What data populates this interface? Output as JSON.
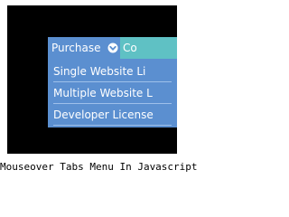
{
  "menu": {
    "tabs": [
      {
        "label": "Purchase",
        "icon": "chevron-down-circle-icon",
        "color": "#5b8fd0"
      },
      {
        "label": "Co",
        "color": "#5fc1c4"
      }
    ],
    "dropdown_items": [
      {
        "label": "Single Website Li"
      },
      {
        "label": "Multiple Website L"
      },
      {
        "label": "Developer License"
      }
    ],
    "dropdown_color": "#5b8fd0"
  },
  "caption": "Mouseover Tabs Menu In Javascript"
}
